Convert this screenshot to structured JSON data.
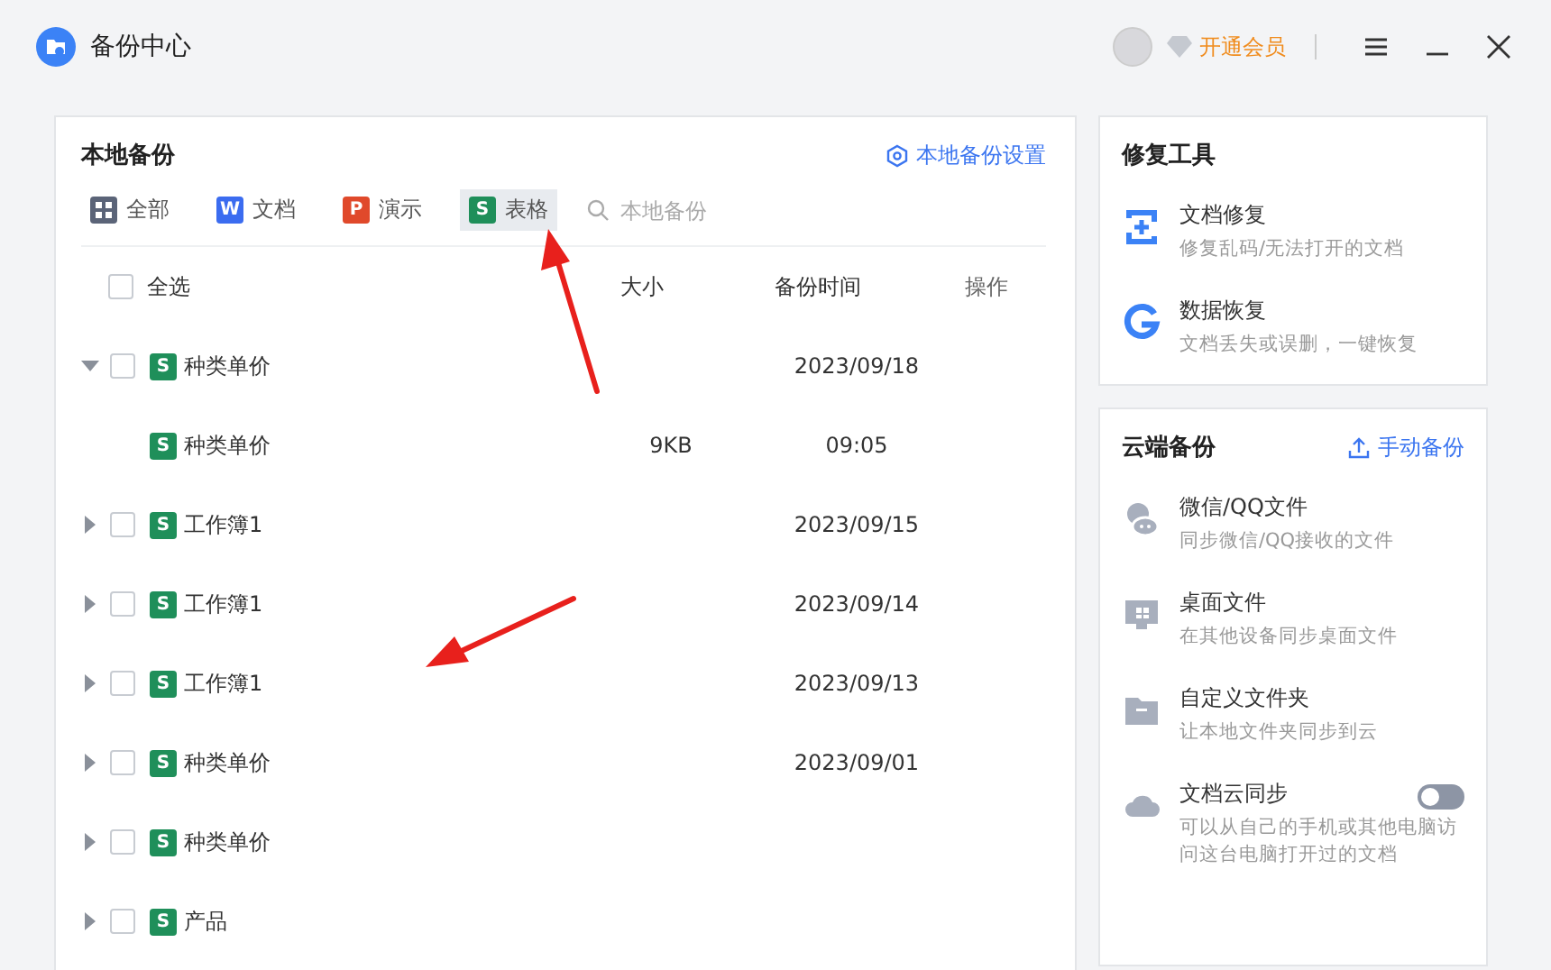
{
  "window": {
    "title": "备份中心",
    "vip": "开通会员"
  },
  "local": {
    "title": "本地备份",
    "settings": "本地备份设置",
    "filters": [
      {
        "kind": "all",
        "label": "全部",
        "selected": false
      },
      {
        "kind": "doc",
        "icon": "W",
        "label": "文档",
        "selected": false
      },
      {
        "kind": "ppt",
        "icon": "P",
        "label": "演示",
        "selected": false
      },
      {
        "kind": "sheet",
        "icon": "S",
        "label": "表格",
        "selected": true
      }
    ],
    "search": {
      "placeholder": "本地备份"
    },
    "select_all_checked": false,
    "columns": {
      "select_all": "全选",
      "size": "大小",
      "time": "备份时间",
      "ops": "操作"
    },
    "rows": [
      {
        "name": "种类单价",
        "icon": "S",
        "size": "",
        "time": "2023/09/18",
        "expanded": true,
        "checked": false,
        "children": [
          {
            "name": "种类单价",
            "icon": "S",
            "size": "9KB",
            "time": "09:05"
          }
        ]
      },
      {
        "name": "工作簿1",
        "icon": "S",
        "size": "",
        "time": "2023/09/15",
        "expanded": false,
        "checked": false
      },
      {
        "name": "工作簿1",
        "icon": "S",
        "size": "",
        "time": "2023/09/14",
        "expanded": false,
        "checked": false
      },
      {
        "name": "工作簿1",
        "icon": "S",
        "size": "",
        "time": "2023/09/13",
        "expanded": false,
        "checked": false
      },
      {
        "name": "种类单价",
        "icon": "S",
        "size": "",
        "time": "2023/09/01",
        "expanded": false,
        "checked": false
      },
      {
        "name": "种类单价",
        "icon": "S",
        "size": "",
        "time": "",
        "expanded": false,
        "checked": false
      },
      {
        "name": "产品",
        "icon": "S",
        "size": "",
        "time": "",
        "expanded": false,
        "checked": false
      }
    ]
  },
  "repair": {
    "title": "修复工具",
    "items": [
      {
        "kind": "doc-repair",
        "title": "文档修复",
        "desc": "修复乱码/无法打开的文档"
      },
      {
        "kind": "data-recovery",
        "title": "数据恢复",
        "desc": "文档丢失或误删，一键恢复"
      }
    ]
  },
  "cloud": {
    "title": "云端备份",
    "action": "手动备份",
    "items": [
      {
        "kind": "chat",
        "title": "微信/QQ文件",
        "desc": "同步微信/QQ接收的文件"
      },
      {
        "kind": "desktop",
        "title": "桌面文件",
        "desc": "在其他设备同步桌面文件"
      },
      {
        "kind": "folder",
        "title": "自定义文件夹",
        "desc": "让本地文件夹同步到云"
      },
      {
        "kind": "cloud",
        "title": "文档云同步",
        "desc": "可以从自己的手机或其他电脑访问这台电脑打开过的文档",
        "on": false
      }
    ]
  }
}
